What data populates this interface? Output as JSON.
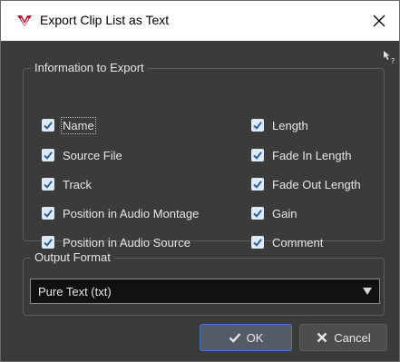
{
  "window": {
    "title": "Export Clip List as Text"
  },
  "info_group": {
    "label": "Information to Export",
    "left_column": [
      {
        "label": "Name",
        "checked": true
      },
      {
        "label": "Source File",
        "checked": true
      },
      {
        "label": "Track",
        "checked": true
      },
      {
        "label": "Position in Audio Montage",
        "checked": true
      },
      {
        "label": "Position in Audio Source",
        "checked": true
      }
    ],
    "right_column": [
      {
        "label": "Length",
        "checked": true
      },
      {
        "label": "Fade In Length",
        "checked": true
      },
      {
        "label": "Fade Out Length",
        "checked": true
      },
      {
        "label": "Gain",
        "checked": true
      },
      {
        "label": "Comment",
        "checked": true
      }
    ]
  },
  "output_group": {
    "label": "Output Format",
    "selected": "Pure Text (txt)"
  },
  "buttons": {
    "ok": "OK",
    "cancel": "Cancel"
  },
  "colors": {
    "checkbox_bg": "#dfe9f3",
    "check_mark": "#2a5d99",
    "ok_border": "#3d7cc9",
    "logo_red": "#c8102e"
  }
}
